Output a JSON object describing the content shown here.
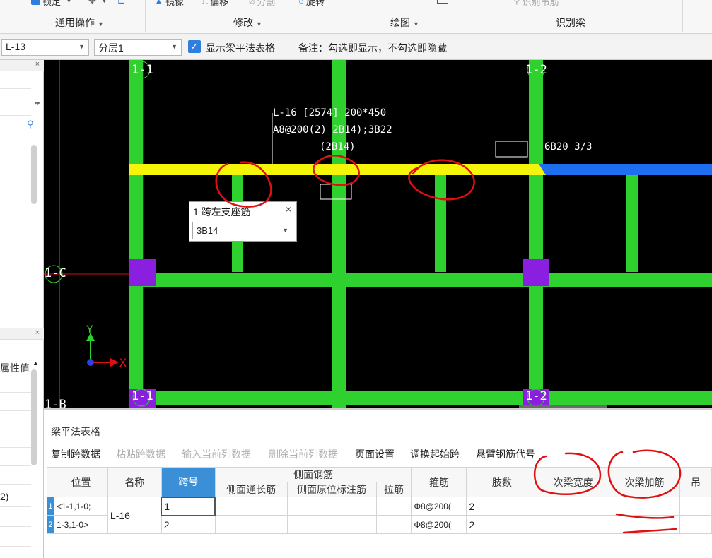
{
  "ribbon": {
    "tools": [
      {
        "label": "锁定",
        "icon": "lock-icon",
        "enabled": true
      },
      {
        "label": "镜像",
        "icon": "mirror-icon",
        "enabled": true
      },
      {
        "label": "偏移",
        "icon": "offset-icon",
        "enabled": true
      },
      {
        "label": "分割",
        "icon": "split-icon",
        "enabled": false
      },
      {
        "label": "旋转",
        "icon": "rotate-icon",
        "enabled": true
      },
      {
        "label": "识别吊筋",
        "icon": "search-icon",
        "enabled": false
      }
    ],
    "groups": [
      "通用操作",
      "修改",
      "绘图",
      "识别梁"
    ]
  },
  "toolbar": {
    "floor_combo": "L-13",
    "layer_combo": "分层1",
    "show_table_checked": true,
    "show_table_label": "显示梁平法表格",
    "note": "备注：勾选即显示，不勾选即隐藏"
  },
  "left_panel": {
    "property_header": "属性值",
    "value_snippet": "2)"
  },
  "canvas": {
    "axis_labels": {
      "top_left": "1-1",
      "top_right": "1-2",
      "middle_left": "1-C",
      "bottom_left": "1-1",
      "bottom_right": "1-2",
      "bottom_edge": "1-B"
    },
    "beam_annotation": {
      "line1": "L-16 [2574] 200*450",
      "line2": "A8@200(2) 2B14);3B22",
      "line3": "(2B14)"
    },
    "right_label": "6B20 3/3",
    "coord_x": "X",
    "coord_y": "Y",
    "popup": {
      "title": "1 跨左支座筋",
      "value": "3B14"
    }
  },
  "table_panel": {
    "title": "梁平法表格",
    "actions": [
      {
        "label": "复制跨数据",
        "enabled": true
      },
      {
        "label": "粘贴跨数据",
        "enabled": false
      },
      {
        "label": "输入当前列数据",
        "enabled": false
      },
      {
        "label": "删除当前列数据",
        "enabled": false
      },
      {
        "label": "页面设置",
        "enabled": true
      },
      {
        "label": "调换起始跨",
        "enabled": true
      },
      {
        "label": "悬臂钢筋代号",
        "enabled": true
      }
    ],
    "headers": {
      "position": "位置",
      "name": "名称",
      "span": "跨号",
      "side_group": "侧面钢筋",
      "side_long": "侧面通长筋",
      "side_mark": "侧面原位标注筋",
      "tie": "拉筋",
      "stirrup": "箍筋",
      "legs": "肢数",
      "sec_width": "次梁宽度",
      "sec_add": "次梁加筋",
      "hang": "吊"
    },
    "rows": [
      {
        "num": "1",
        "position": "<1-1,1-0;",
        "name": "L-16",
        "span": "1",
        "stirrup": "Φ8@200(",
        "legs": "2"
      },
      {
        "num": "2",
        "position": "1-3,1-0>",
        "name": "",
        "span": "2",
        "stirrup": "Φ8@200(",
        "legs": "2"
      }
    ]
  },
  "colors": {
    "beam_green": "#2ed12e",
    "beam_yellow": "#f5f50a",
    "beam_blue": "#1e6ff0",
    "column_purple": "#8a1fe0",
    "annotation_red": "#e01010",
    "accent_blue": "#3b8fd6"
  }
}
